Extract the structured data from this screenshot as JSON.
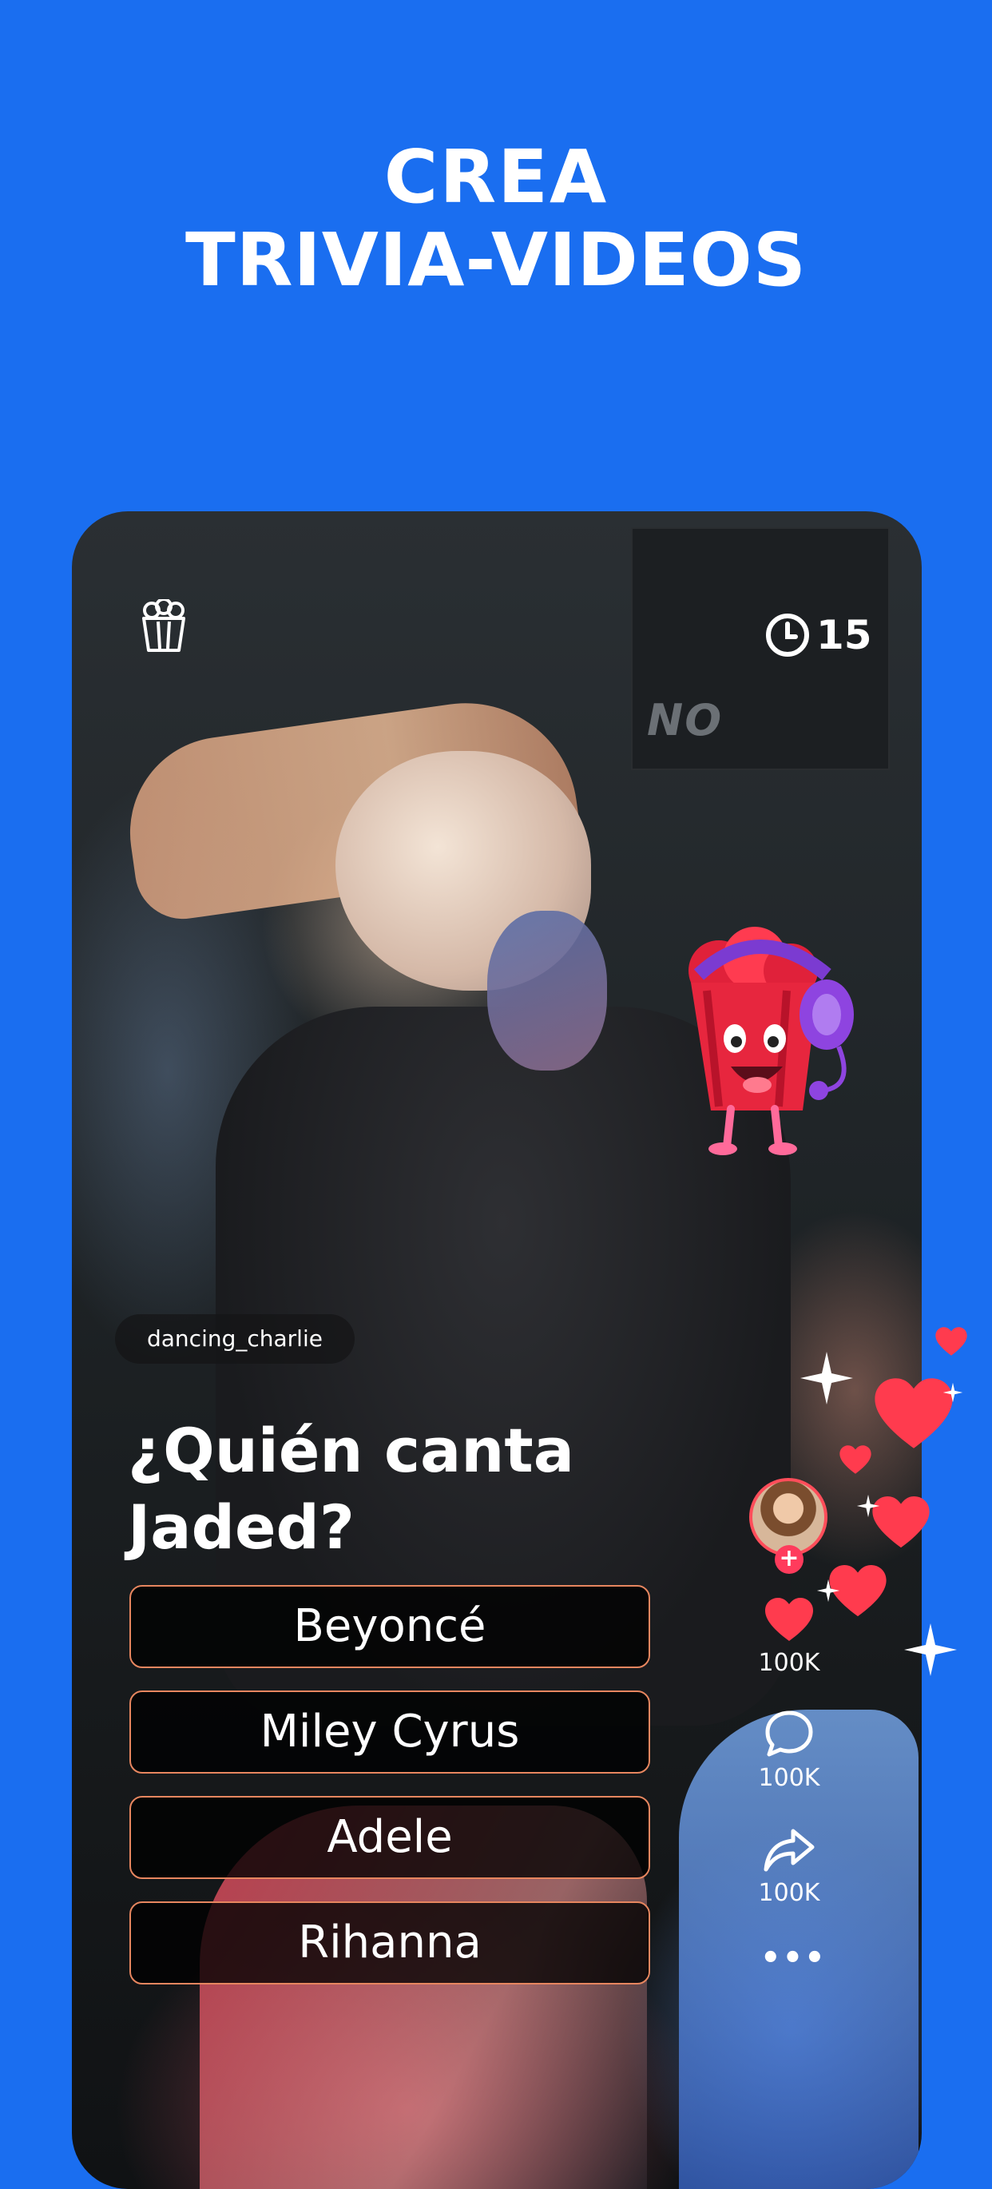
{
  "headline": {
    "line1": "CREA",
    "line2": "TRIVIA-VIDEOS"
  },
  "post": {
    "timer": "15",
    "username": "dancing_charlie",
    "question": "¿Quién canta Jaded?",
    "answers": [
      "Beyoncé",
      "Miley Cyrus",
      "Adele",
      "Rihanna"
    ]
  },
  "sidebar": {
    "likes": "100K",
    "comments": "100K",
    "shares": "100K",
    "more": "•••"
  },
  "icons": [
    "popcorn-icon",
    "clock-icon",
    "heart-icon",
    "comment-icon",
    "share-icon",
    "more-icon",
    "follow-plus-icon"
  ],
  "colors": {
    "background": "#1a6ef0",
    "answer_border": "#e7865f",
    "heart": "#ff3b4e"
  }
}
